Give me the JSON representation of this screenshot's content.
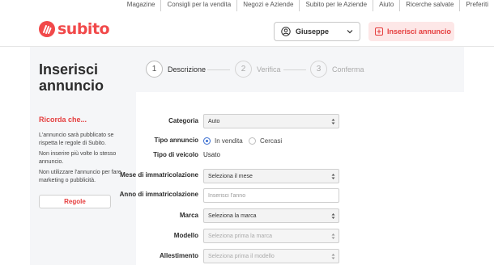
{
  "top_links": [
    "Magazine",
    "Consigli per la vendita",
    "Negozi e Aziende",
    "Subito per le Aziende",
    "Aiuto",
    "Ricerche salvate",
    "Preferiti"
  ],
  "header": {
    "logo_text": "subito",
    "user_name": "Giuseppe",
    "insert_button": "Inserisci annuncio"
  },
  "page_title": [
    "Inserisci",
    "annuncio"
  ],
  "steps": [
    {
      "num": "1",
      "label": "Descrizione",
      "active": true
    },
    {
      "num": "2",
      "label": "Verifica",
      "active": false
    },
    {
      "num": "3",
      "label": "Conferma",
      "active": false
    }
  ],
  "sidebar": {
    "reminder_title": "Ricorda che...",
    "notes": [
      "L'annuncio sarà pubblicato se rispetta le regole di Subito.",
      "Non inserire più volte lo stesso annuncio.",
      "Non utilizzare l'annuncio per fare marketing o pubblicità."
    ],
    "rules_button": "Regole"
  },
  "form": {
    "category": {
      "label": "Categoria",
      "value": "Auto"
    },
    "ad_type": {
      "label": "Tipo annuncio",
      "options": [
        "In vendita",
        "Cercasi"
      ],
      "selected": "In vendita"
    },
    "vehicle_type": {
      "label": "Tipo di veicolo",
      "value": "Usato"
    },
    "reg_month": {
      "label": "Mese di immatricolazione",
      "value": "Seleziona il mese"
    },
    "reg_year": {
      "label": "Anno di immatricolazione",
      "placeholder": "Inserisci l'anno"
    },
    "brand": {
      "label": "Marca",
      "value": "Seleziona la marca"
    },
    "model": {
      "label": "Modello",
      "value": "Seleziona prima la marca"
    },
    "trim": {
      "label": "Allestimento",
      "value": "Seleziona prima il modello"
    }
  },
  "colors": {
    "brand": "#f1494a",
    "accent_radio": "#3b6fd1",
    "panel_bg": "#f5f6f8"
  }
}
